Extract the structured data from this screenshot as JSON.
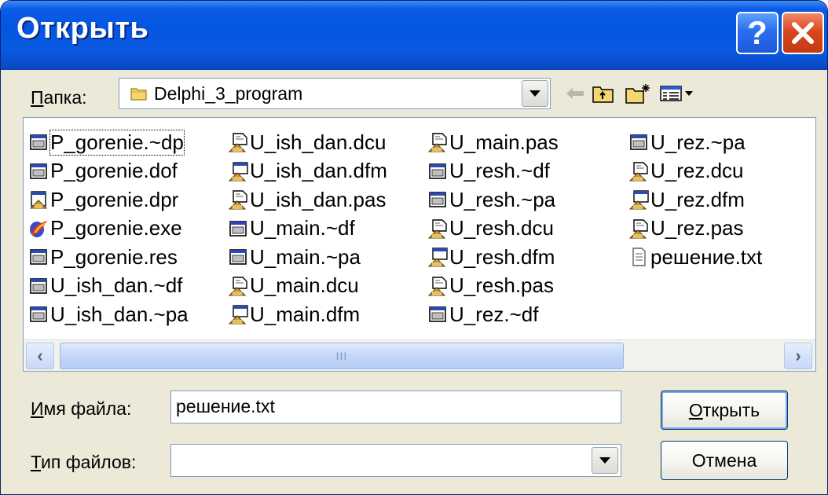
{
  "window": {
    "title": "Открыть"
  },
  "folder_bar": {
    "label_underlined": "П",
    "label_rest": "апка:",
    "current_folder": "Delphi_3_program"
  },
  "files": [
    {
      "name": "P_gorenie.~dp",
      "icon": "form-file-icon"
    },
    {
      "name": "P_gorenie.dof",
      "icon": "form-file-icon"
    },
    {
      "name": "P_gorenie.dpr",
      "icon": "delphi-project-icon"
    },
    {
      "name": "P_gorenie.exe",
      "icon": "executable-icon"
    },
    {
      "name": "P_gorenie.res",
      "icon": "form-file-icon"
    },
    {
      "name": "U_ish_dan.~df",
      "icon": "form-file-icon"
    },
    {
      "name": "U_ish_dan.~pa",
      "icon": "form-file-icon"
    },
    {
      "name": "U_ish_dan.dcu",
      "icon": "delphi-unit-icon"
    },
    {
      "name": "U_ish_dan.dfm",
      "icon": "delphi-form-icon"
    },
    {
      "name": "U_ish_dan.pas",
      "icon": "delphi-unit-icon"
    },
    {
      "name": "U_main.~df",
      "icon": "form-file-icon"
    },
    {
      "name": "U_main.~pa",
      "icon": "form-file-icon"
    },
    {
      "name": "U_main.dcu",
      "icon": "delphi-unit-icon"
    },
    {
      "name": "U_main.dfm",
      "icon": "delphi-form-icon"
    },
    {
      "name": "U_main.pas",
      "icon": "delphi-unit-icon"
    },
    {
      "name": "U_resh.~df",
      "icon": "form-file-icon"
    },
    {
      "name": "U_resh.~pa",
      "icon": "form-file-icon"
    },
    {
      "name": "U_resh.dcu",
      "icon": "delphi-unit-icon"
    },
    {
      "name": "U_resh.dfm",
      "icon": "delphi-form-icon"
    },
    {
      "name": "U_resh.pas",
      "icon": "delphi-unit-icon"
    },
    {
      "name": "U_rez.~df",
      "icon": "form-file-icon"
    },
    {
      "name": "U_rez.~pa",
      "icon": "form-file-icon"
    },
    {
      "name": "U_rez.dcu",
      "icon": "delphi-unit-icon"
    },
    {
      "name": "U_rez.dfm",
      "icon": "delphi-form-icon"
    },
    {
      "name": "U_rez.pas",
      "icon": "delphi-unit-icon"
    },
    {
      "name": "решение.txt",
      "icon": "text-file-icon"
    }
  ],
  "scrollbar": {
    "thumb_grip": "III"
  },
  "filename_row": {
    "label_underlined": "И",
    "label_rest": "мя файла:",
    "value": "решение.txt"
  },
  "filetype_row": {
    "label_underlined": "Т",
    "label_rest": "ип файлов:",
    "value": ""
  },
  "buttons": {
    "open_underlined": "О",
    "open_rest": "ткрыть",
    "cancel": "Отмена"
  },
  "colors": {
    "titlebar": "#0356e2",
    "dialog_bg": "#ece9d8",
    "close": "#d9481e"
  }
}
